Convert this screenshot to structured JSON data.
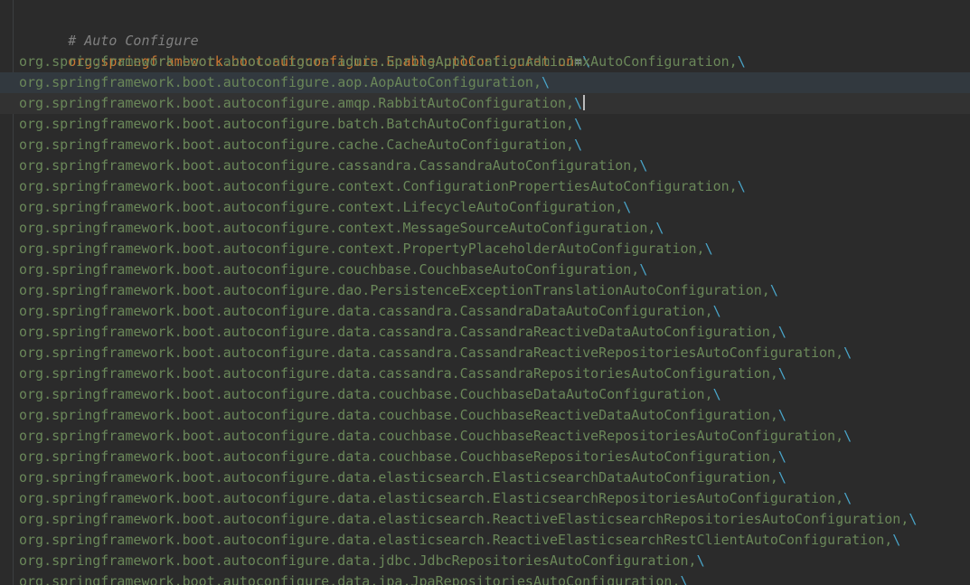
{
  "comment": "# Auto Configure",
  "header_key": "org.springframework.boot.autoconfigure.EnableAutoConfiguration",
  "equals": "=",
  "continuation": "\\",
  "entries": [
    "org.springframework.boot.autoconfigure.admin.SpringApplicationAdminJmxAutoConfiguration,",
    "org.springframework.boot.autoconfigure.aop.AopAutoConfiguration,",
    "org.springframework.boot.autoconfigure.amqp.RabbitAutoConfiguration,",
    "org.springframework.boot.autoconfigure.batch.BatchAutoConfiguration,",
    "org.springframework.boot.autoconfigure.cache.CacheAutoConfiguration,",
    "org.springframework.boot.autoconfigure.cassandra.CassandraAutoConfiguration,",
    "org.springframework.boot.autoconfigure.context.ConfigurationPropertiesAutoConfiguration,",
    "org.springframework.boot.autoconfigure.context.LifecycleAutoConfiguration,",
    "org.springframework.boot.autoconfigure.context.MessageSourceAutoConfiguration,",
    "org.springframework.boot.autoconfigure.context.PropertyPlaceholderAutoConfiguration,",
    "org.springframework.boot.autoconfigure.couchbase.CouchbaseAutoConfiguration,",
    "org.springframework.boot.autoconfigure.dao.PersistenceExceptionTranslationAutoConfiguration,",
    "org.springframework.boot.autoconfigure.data.cassandra.CassandraDataAutoConfiguration,",
    "org.springframework.boot.autoconfigure.data.cassandra.CassandraReactiveDataAutoConfiguration,",
    "org.springframework.boot.autoconfigure.data.cassandra.CassandraReactiveRepositoriesAutoConfiguration,",
    "org.springframework.boot.autoconfigure.data.cassandra.CassandraRepositoriesAutoConfiguration,",
    "org.springframework.boot.autoconfigure.data.couchbase.CouchbaseDataAutoConfiguration,",
    "org.springframework.boot.autoconfigure.data.couchbase.CouchbaseReactiveDataAutoConfiguration,",
    "org.springframework.boot.autoconfigure.data.couchbase.CouchbaseReactiveRepositoriesAutoConfiguration,",
    "org.springframework.boot.autoconfigure.data.couchbase.CouchbaseRepositoriesAutoConfiguration,",
    "org.springframework.boot.autoconfigure.data.elasticsearch.ElasticsearchDataAutoConfiguration,",
    "org.springframework.boot.autoconfigure.data.elasticsearch.ElasticsearchRepositoriesAutoConfiguration,",
    "org.springframework.boot.autoconfigure.data.elasticsearch.ReactiveElasticsearchRepositoriesAutoConfiguration,",
    "org.springframework.boot.autoconfigure.data.elasticsearch.ReactiveElasticsearchRestClientAutoConfiguration,",
    "org.springframework.boot.autoconfigure.data.jdbc.JdbcRepositoriesAutoConfiguration,",
    "org.springframework.boot.autoconfigure.data.jpa.JpaRepositoriesAutoConfiguration,"
  ],
  "intention_icon": "lightbulb-icon",
  "colors": {
    "background": "#2b2b2b",
    "comment": "#808080",
    "key": "#cc7832",
    "value": "#6a8759",
    "continuation": "#49a4c8"
  }
}
